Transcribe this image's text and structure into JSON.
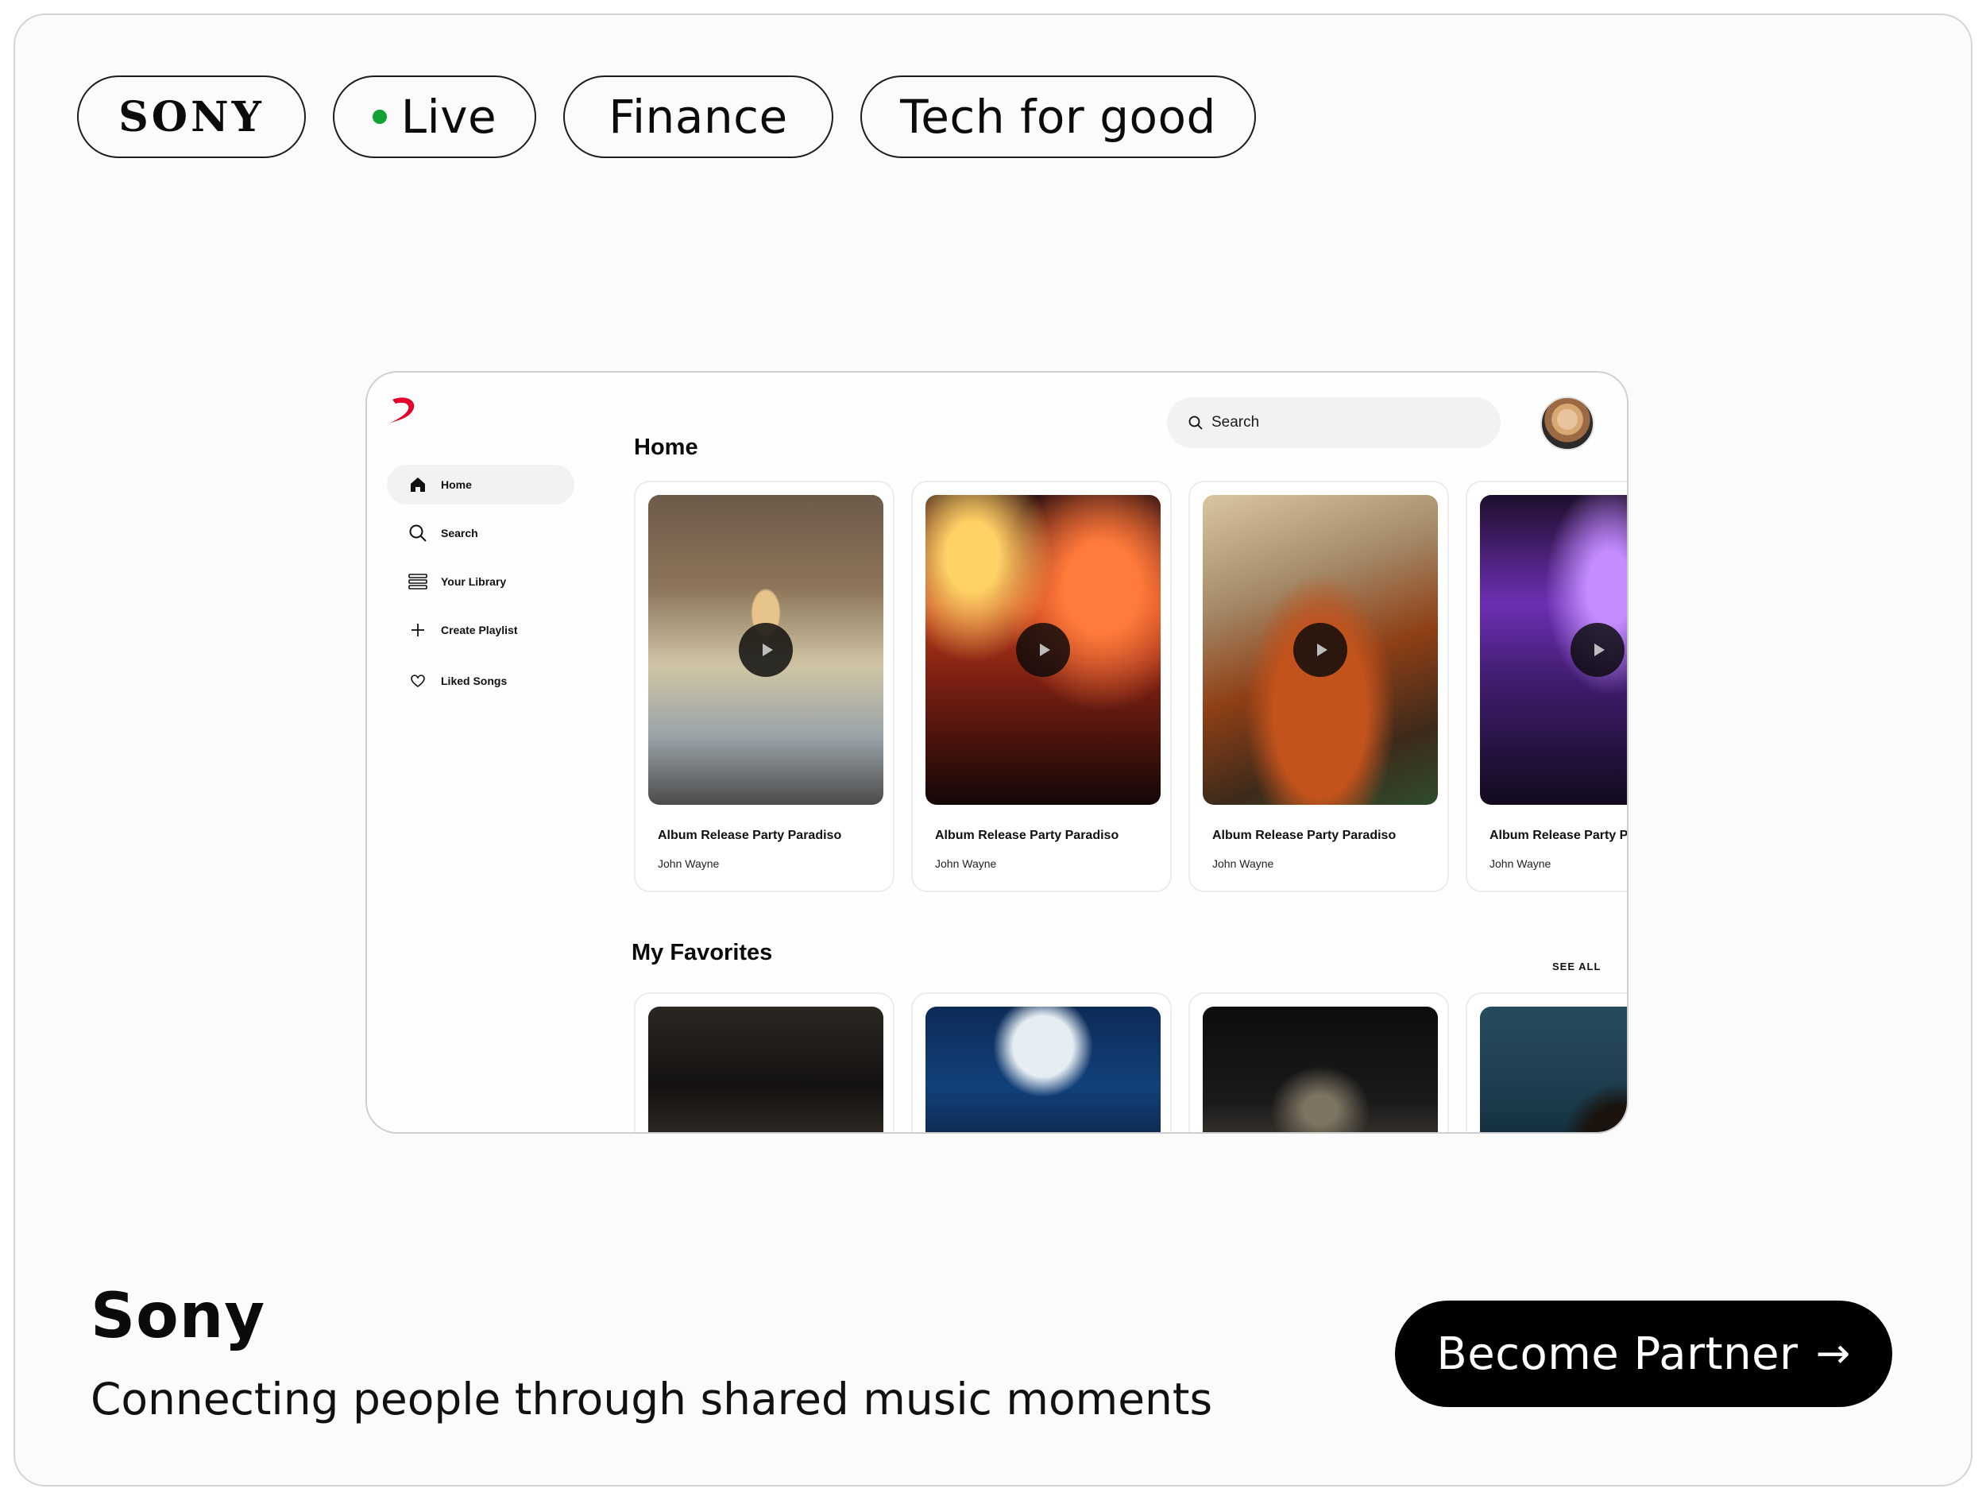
{
  "tags": {
    "brand": "SONY",
    "live": "Live",
    "finance": "Finance",
    "tech": "Tech for good"
  },
  "colors": {
    "live_dot": "#12a133",
    "brand_accent": "#e4002b",
    "cta_bg": "#000000"
  },
  "app": {
    "sidebar": {
      "items": [
        {
          "label": "Home",
          "icon": "home-icon",
          "active": true
        },
        {
          "label": "Search",
          "icon": "search-icon"
        },
        {
          "label": "Your Library",
          "icon": "library-icon"
        },
        {
          "label": "Create Playlist",
          "icon": "plus-icon"
        },
        {
          "label": "Liked Songs",
          "icon": "heart-icon"
        }
      ]
    },
    "header": {
      "title": "Home",
      "search_placeholder": "Search"
    },
    "home_cards": [
      {
        "title": "Album Release Party Paradiso",
        "artist": "John Wayne"
      },
      {
        "title": "Album Release Party Paradiso",
        "artist": "John Wayne"
      },
      {
        "title": "Album Release Party Paradiso",
        "artist": "John Wayne"
      },
      {
        "title": "Album Release Party Pa",
        "artist": "John Wayne"
      }
    ],
    "favorites": {
      "title": "My Favorites",
      "see_all": "SEE ALL"
    }
  },
  "footer": {
    "company": "Sony",
    "tagline": "Connecting people through shared music moments",
    "cta_label": "Become Partner",
    "cta_arrow": "→"
  }
}
